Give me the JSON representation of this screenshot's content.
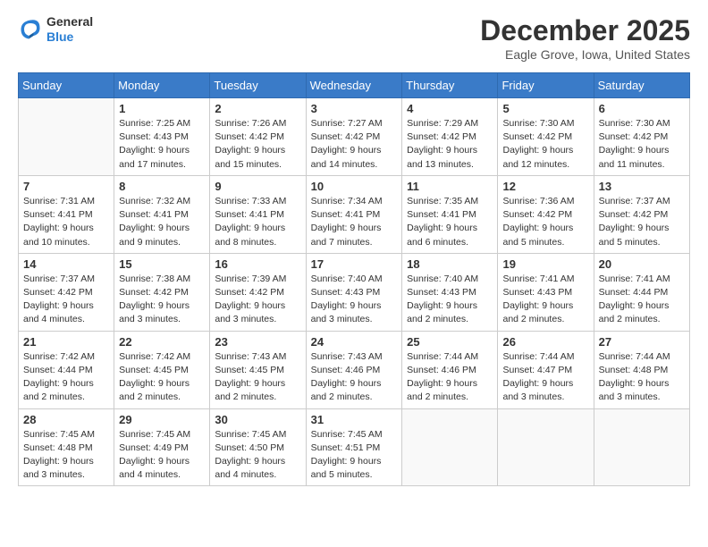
{
  "header": {
    "logo_general": "General",
    "logo_blue": "Blue",
    "month_title": "December 2025",
    "location": "Eagle Grove, Iowa, United States"
  },
  "days_of_week": [
    "Sunday",
    "Monday",
    "Tuesday",
    "Wednesday",
    "Thursday",
    "Friday",
    "Saturday"
  ],
  "weeks": [
    [
      {
        "day": "",
        "info": ""
      },
      {
        "day": "1",
        "info": "Sunrise: 7:25 AM\nSunset: 4:43 PM\nDaylight: 9 hours\nand 17 minutes."
      },
      {
        "day": "2",
        "info": "Sunrise: 7:26 AM\nSunset: 4:42 PM\nDaylight: 9 hours\nand 15 minutes."
      },
      {
        "day": "3",
        "info": "Sunrise: 7:27 AM\nSunset: 4:42 PM\nDaylight: 9 hours\nand 14 minutes."
      },
      {
        "day": "4",
        "info": "Sunrise: 7:29 AM\nSunset: 4:42 PM\nDaylight: 9 hours\nand 13 minutes."
      },
      {
        "day": "5",
        "info": "Sunrise: 7:30 AM\nSunset: 4:42 PM\nDaylight: 9 hours\nand 12 minutes."
      },
      {
        "day": "6",
        "info": "Sunrise: 7:30 AM\nSunset: 4:42 PM\nDaylight: 9 hours\nand 11 minutes."
      }
    ],
    [
      {
        "day": "7",
        "info": "Sunrise: 7:31 AM\nSunset: 4:41 PM\nDaylight: 9 hours\nand 10 minutes."
      },
      {
        "day": "8",
        "info": "Sunrise: 7:32 AM\nSunset: 4:41 PM\nDaylight: 9 hours\nand 9 minutes."
      },
      {
        "day": "9",
        "info": "Sunrise: 7:33 AM\nSunset: 4:41 PM\nDaylight: 9 hours\nand 8 minutes."
      },
      {
        "day": "10",
        "info": "Sunrise: 7:34 AM\nSunset: 4:41 PM\nDaylight: 9 hours\nand 7 minutes."
      },
      {
        "day": "11",
        "info": "Sunrise: 7:35 AM\nSunset: 4:41 PM\nDaylight: 9 hours\nand 6 minutes."
      },
      {
        "day": "12",
        "info": "Sunrise: 7:36 AM\nSunset: 4:42 PM\nDaylight: 9 hours\nand 5 minutes."
      },
      {
        "day": "13",
        "info": "Sunrise: 7:37 AM\nSunset: 4:42 PM\nDaylight: 9 hours\nand 5 minutes."
      }
    ],
    [
      {
        "day": "14",
        "info": "Sunrise: 7:37 AM\nSunset: 4:42 PM\nDaylight: 9 hours\nand 4 minutes."
      },
      {
        "day": "15",
        "info": "Sunrise: 7:38 AM\nSunset: 4:42 PM\nDaylight: 9 hours\nand 3 minutes."
      },
      {
        "day": "16",
        "info": "Sunrise: 7:39 AM\nSunset: 4:42 PM\nDaylight: 9 hours\nand 3 minutes."
      },
      {
        "day": "17",
        "info": "Sunrise: 7:40 AM\nSunset: 4:43 PM\nDaylight: 9 hours\nand 3 minutes."
      },
      {
        "day": "18",
        "info": "Sunrise: 7:40 AM\nSunset: 4:43 PM\nDaylight: 9 hours\nand 2 minutes."
      },
      {
        "day": "19",
        "info": "Sunrise: 7:41 AM\nSunset: 4:43 PM\nDaylight: 9 hours\nand 2 minutes."
      },
      {
        "day": "20",
        "info": "Sunrise: 7:41 AM\nSunset: 4:44 PM\nDaylight: 9 hours\nand 2 minutes."
      }
    ],
    [
      {
        "day": "21",
        "info": "Sunrise: 7:42 AM\nSunset: 4:44 PM\nDaylight: 9 hours\nand 2 minutes."
      },
      {
        "day": "22",
        "info": "Sunrise: 7:42 AM\nSunset: 4:45 PM\nDaylight: 9 hours\nand 2 minutes."
      },
      {
        "day": "23",
        "info": "Sunrise: 7:43 AM\nSunset: 4:45 PM\nDaylight: 9 hours\nand 2 minutes."
      },
      {
        "day": "24",
        "info": "Sunrise: 7:43 AM\nSunset: 4:46 PM\nDaylight: 9 hours\nand 2 minutes."
      },
      {
        "day": "25",
        "info": "Sunrise: 7:44 AM\nSunset: 4:46 PM\nDaylight: 9 hours\nand 2 minutes."
      },
      {
        "day": "26",
        "info": "Sunrise: 7:44 AM\nSunset: 4:47 PM\nDaylight: 9 hours\nand 3 minutes."
      },
      {
        "day": "27",
        "info": "Sunrise: 7:44 AM\nSunset: 4:48 PM\nDaylight: 9 hours\nand 3 minutes."
      }
    ],
    [
      {
        "day": "28",
        "info": "Sunrise: 7:45 AM\nSunset: 4:48 PM\nDaylight: 9 hours\nand 3 minutes."
      },
      {
        "day": "29",
        "info": "Sunrise: 7:45 AM\nSunset: 4:49 PM\nDaylight: 9 hours\nand 4 minutes."
      },
      {
        "day": "30",
        "info": "Sunrise: 7:45 AM\nSunset: 4:50 PM\nDaylight: 9 hours\nand 4 minutes."
      },
      {
        "day": "31",
        "info": "Sunrise: 7:45 AM\nSunset: 4:51 PM\nDaylight: 9 hours\nand 5 minutes."
      },
      {
        "day": "",
        "info": ""
      },
      {
        "day": "",
        "info": ""
      },
      {
        "day": "",
        "info": ""
      }
    ]
  ]
}
